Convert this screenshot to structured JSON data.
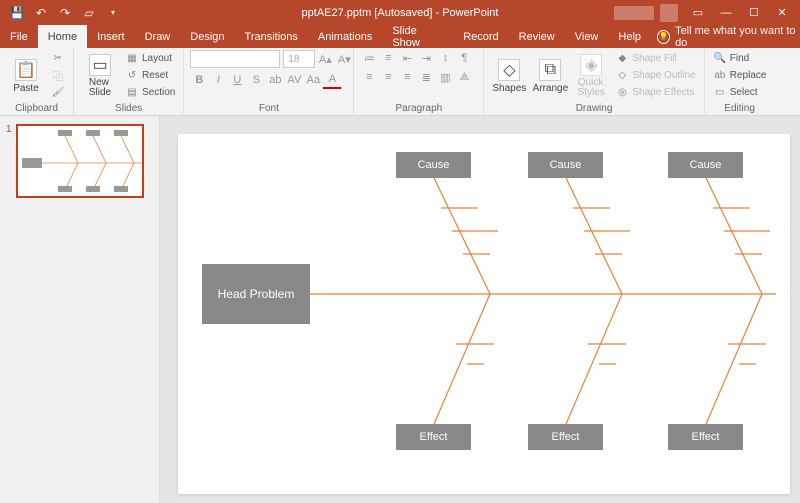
{
  "app": {
    "title": "pptAE27.pptm [Autosaved]  -  PowerPoint"
  },
  "tabs": {
    "file": "File",
    "home": "Home",
    "insert": "Insert",
    "draw": "Draw",
    "design": "Design",
    "transitions": "Transitions",
    "animations": "Animations",
    "slideshow": "Slide Show",
    "record": "Record",
    "review": "Review",
    "view": "View",
    "help": "Help",
    "tell": "Tell me what you want to do"
  },
  "ribbon": {
    "clipboard": {
      "label": "Clipboard",
      "paste": "Paste"
    },
    "slides": {
      "label": "Slides",
      "newslide": "New\nSlide",
      "layout": "Layout",
      "reset": "Reset",
      "section": "Section"
    },
    "font": {
      "label": "Font",
      "size": "18"
    },
    "paragraph": {
      "label": "Paragraph"
    },
    "drawing": {
      "label": "Drawing",
      "shapes": "Shapes",
      "arrange": "Arrange",
      "quick": "Quick\nStyles",
      "fill": "Shape Fill",
      "outline": "Shape Outline",
      "effects": "Shape Effects"
    },
    "editing": {
      "label": "Editing",
      "find": "Find",
      "replace": "Replace",
      "select": "Select"
    }
  },
  "thumb": {
    "num": "1"
  },
  "slide": {
    "head": "Head Problem",
    "causes": [
      "Cause",
      "Cause",
      "Cause"
    ],
    "effects": [
      "Effect",
      "Effect",
      "Effect"
    ]
  }
}
